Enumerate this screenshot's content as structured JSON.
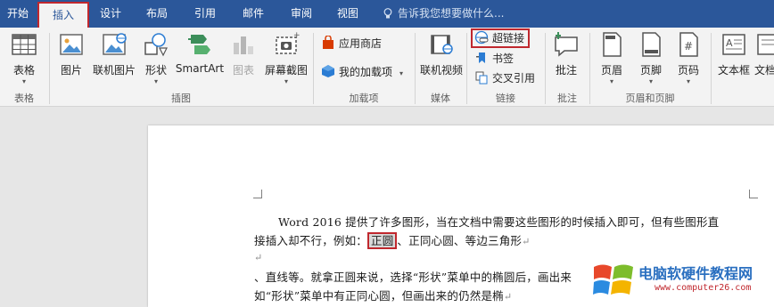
{
  "tabs": [
    {
      "label": "开始"
    },
    {
      "label": "插入"
    },
    {
      "label": "设计"
    },
    {
      "label": "布局"
    },
    {
      "label": "引用"
    },
    {
      "label": "邮件"
    },
    {
      "label": "审阅"
    },
    {
      "label": "视图"
    }
  ],
  "tell_me": "告诉我您想要做什么...",
  "ribbon": {
    "table": {
      "label": "表格",
      "group": "表格"
    },
    "illustrations": {
      "picture": "图片",
      "online_picture": "联机图片",
      "shapes": "形状",
      "smartart": "SmartArt",
      "chart": "图表",
      "screenshot": "屏幕截图",
      "group": "插图"
    },
    "addins": {
      "store": "应用商店",
      "my_addins": "我的加载项",
      "group": "加载项"
    },
    "media": {
      "online_video": "联机视频",
      "group": "媒体"
    },
    "links": {
      "hyperlink": "超链接",
      "bookmark": "书签",
      "cross_ref": "交叉引用",
      "group": "链接"
    },
    "comments": {
      "comment": "批注",
      "group": "批注"
    },
    "header_footer": {
      "header": "页眉",
      "footer": "页脚",
      "page_number": "页码",
      "group": "页眉和页脚"
    },
    "text": {
      "textbox": "文本框",
      "more": "文档"
    }
  },
  "document": {
    "line1": "Word 2016 提供了许多图形，当在文档中需要这些图形的时候插入即可，但有些图形直",
    "line2_pre": "接插入却不行，例如：",
    "line2_hl": "正圆",
    "line2_post": "、正同心圆、等边三角形",
    "line4": "、直线等。就拿正圆来说，选择“形状”菜单中的椭圆后，画出来",
    "line5": "如“形状”菜单中有正同心圆，但画出来的仍然是椭"
  },
  "watermark": {
    "title": "电脑软硬件教程网",
    "url": "www.computer26.com"
  }
}
